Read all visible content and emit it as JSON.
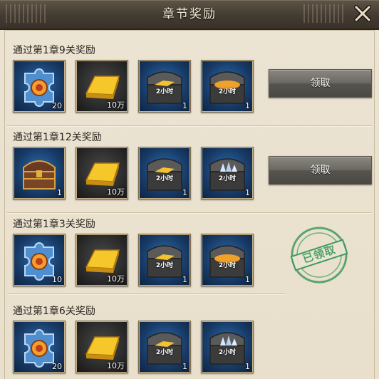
{
  "window": {
    "title": "章节奖励",
    "close_icon": "close-x-icon"
  },
  "colors": {
    "panel_bg": "#ece4d3",
    "header_bg": "#433b31",
    "stamp_green": "#3f9a5c",
    "button_gray": "#6b6962"
  },
  "sections": [
    {
      "title": "通过第1章9关奖励",
      "items": [
        {
          "icon": "puzzle-piece-icon",
          "count": "20"
        },
        {
          "icon": "gold-bar-icon",
          "count": "10万"
        },
        {
          "icon": "gold-chest-icon",
          "label": "2小时",
          "count": "1"
        },
        {
          "icon": "food-chest-icon",
          "label": "2小时",
          "count": "1"
        }
      ],
      "action": {
        "type": "button",
        "label": "领取"
      }
    },
    {
      "title": "通过第1章12关奖励",
      "items": [
        {
          "icon": "treasure-chest-icon",
          "count": "1"
        },
        {
          "icon": "gold-bar-icon",
          "count": "10万"
        },
        {
          "icon": "gold-chest-icon",
          "label": "2小时",
          "count": "1"
        },
        {
          "icon": "crystal-chest-icon",
          "label": "2小时",
          "count": "1"
        }
      ],
      "action": {
        "type": "button",
        "label": "领取"
      }
    },
    {
      "title": "通过第1章3关奖励",
      "items": [
        {
          "icon": "puzzle-piece-icon",
          "count": "10"
        },
        {
          "icon": "gold-bar-icon",
          "count": "10万"
        },
        {
          "icon": "gold-chest-icon",
          "label": "2小时",
          "count": "1"
        },
        {
          "icon": "food-chest-icon",
          "label": "2小时",
          "count": "1"
        }
      ],
      "action": {
        "type": "stamp",
        "label": "已领取"
      }
    },
    {
      "title": "通过第1章6关奖励",
      "items": [
        {
          "icon": "puzzle-piece-icon",
          "count": "20"
        },
        {
          "icon": "gold-bar-icon",
          "count": "10万"
        },
        {
          "icon": "gold-chest-icon",
          "label": "2小时",
          "count": "1"
        },
        {
          "icon": "crystal-chest-icon",
          "label": "2小时",
          "count": "1"
        }
      ],
      "action": {
        "type": "none"
      }
    }
  ]
}
